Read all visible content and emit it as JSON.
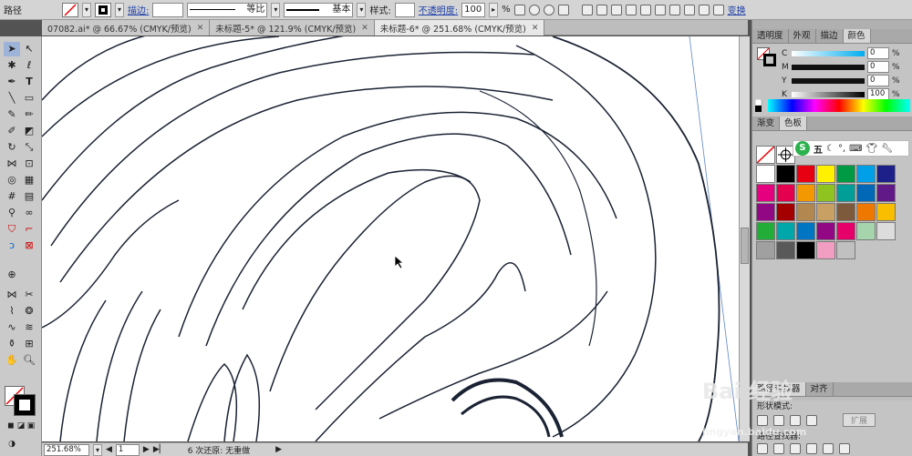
{
  "control_bar": {
    "object_type": "路径",
    "stroke_label": "描边:",
    "stroke_value": "",
    "uniform_label": "等比",
    "profile_label": "基本",
    "style_label": "样式:",
    "opacity_label": "不透明度:",
    "opacity_value": "100",
    "percent": "%",
    "transform_label": "变换"
  },
  "tabs": [
    {
      "label": "07082.ai* @ 66.67% (CMYK/预览)",
      "active": false
    },
    {
      "label": "未标题-5* @ 121.9% (CMYK/预览)",
      "active": false
    },
    {
      "label": "未标题-6* @ 251.68% (CMYK/预览)",
      "active": true
    }
  ],
  "status": {
    "zoom": "251.68%",
    "page": "1",
    "message": "6 次还原: 无重做"
  },
  "panel_tabs_top": [
    "透明度",
    "外观",
    "描边",
    "颜色"
  ],
  "color": {
    "c_label": "C",
    "m_label": "M",
    "y_label": "Y",
    "k_label": "K",
    "c": "0",
    "m": "0",
    "y": "0",
    "k": "100",
    "unit": "%"
  },
  "panel_tabs_mid": [
    "渐变",
    "色板"
  ],
  "swatch_colors": [
    "#ffffff",
    "#000000",
    "#e60012",
    "#fff100",
    "#009944",
    "#00a0e9",
    "#1d2088",
    "#e4007f",
    "#e5004f",
    "#f39800",
    "#8fc31f",
    "#009e96",
    "#0068b7",
    "#601986",
    "#920783",
    "#a40000",
    "#b28850",
    "#c9a063",
    "#7d5a3c",
    "#ee7800",
    "#fabe00",
    "#22ac38",
    "#00a7aa",
    "#0075c2",
    "#920783",
    "#e5006a",
    "#a5d4ad",
    "#dcdcdc",
    "#a0a0a0",
    "#595959",
    "#000000",
    "#f19ec2",
    "#c0c0c0"
  ],
  "panel_tabs_bottom": [
    "路径查找器",
    "对齐"
  ],
  "pathfinder": {
    "shape_modes": "形状模式:",
    "pathfinders": "路径查找器:",
    "expand": "扩展"
  },
  "ime": {
    "logo": "S",
    "text": "五"
  },
  "watermark": {
    "site": "Bai 经验",
    "url": "jingyan.baidu.com"
  }
}
